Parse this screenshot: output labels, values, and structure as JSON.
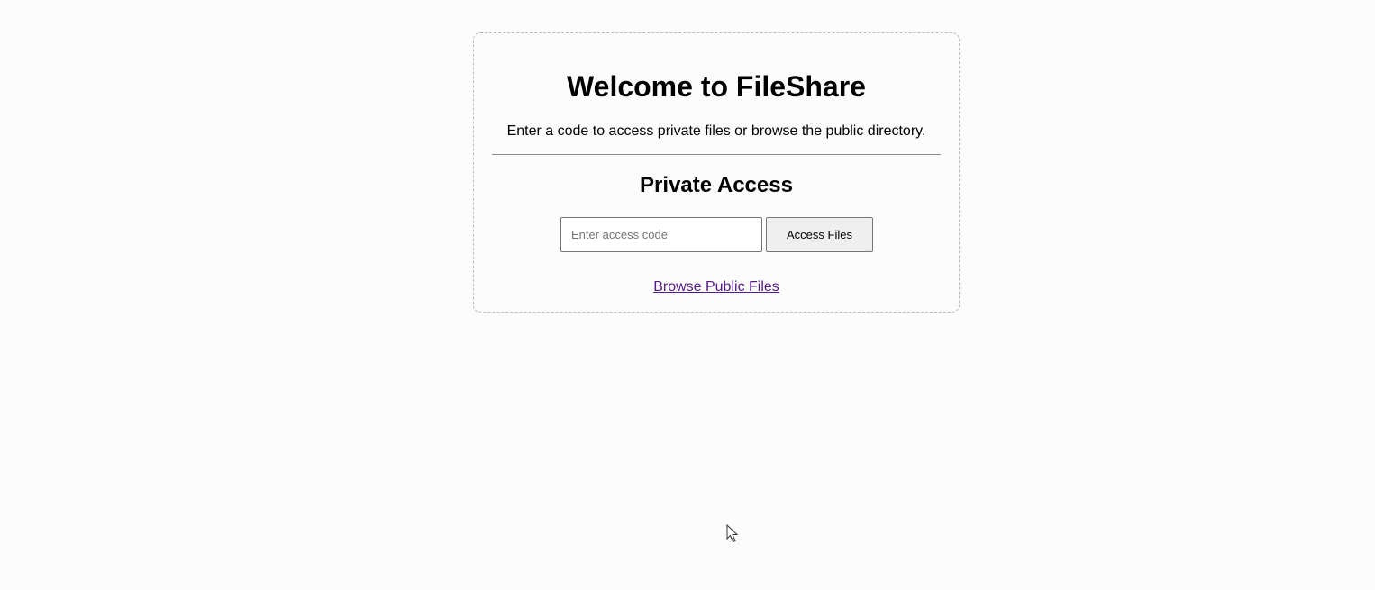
{
  "page": {
    "title": "Welcome to FileShare",
    "subtitle": "Enter a code to access private files or browse the public directory."
  },
  "private_access": {
    "heading": "Private Access",
    "code_input": {
      "value": "",
      "placeholder": "Enter access code"
    },
    "submit_label": "Access Files"
  },
  "public_link": {
    "label": "Browse Public Files"
  },
  "colors": {
    "background": "#fcfcfc",
    "card_border": "#b9b9c8",
    "link_visited": "#551a8b",
    "button_bg": "#efefef"
  },
  "icons": {
    "cursor": "mouse-pointer-icon"
  }
}
